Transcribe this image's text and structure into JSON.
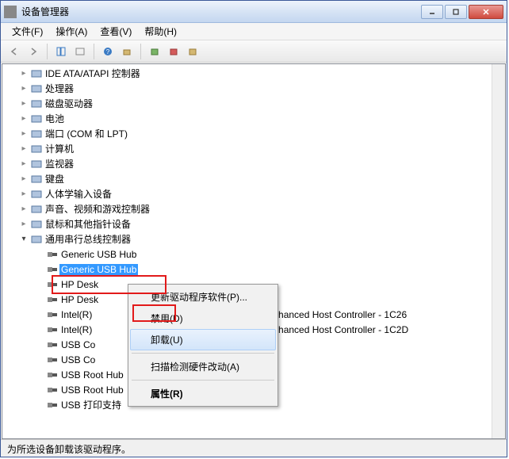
{
  "window": {
    "title": "设备管理器"
  },
  "menu": {
    "file": "文件(F)",
    "action": "操作(A)",
    "view": "查看(V)",
    "help": "帮助(H)"
  },
  "tree": {
    "items": [
      {
        "label": "IDE ATA/ATAPI 控制器",
        "indent": 1,
        "expanded": false
      },
      {
        "label": "处理器",
        "indent": 1,
        "expanded": false
      },
      {
        "label": "磁盘驱动器",
        "indent": 1,
        "expanded": false
      },
      {
        "label": "电池",
        "indent": 1,
        "expanded": false
      },
      {
        "label": "端口 (COM 和 LPT)",
        "indent": 1,
        "expanded": false
      },
      {
        "label": "计算机",
        "indent": 1,
        "expanded": false
      },
      {
        "label": "监视器",
        "indent": 1,
        "expanded": false
      },
      {
        "label": "键盘",
        "indent": 1,
        "expanded": false
      },
      {
        "label": "人体学输入设备",
        "indent": 1,
        "expanded": false
      },
      {
        "label": "声音、视频和游戏控制器",
        "indent": 1,
        "expanded": false
      },
      {
        "label": "鼠标和其他指针设备",
        "indent": 1,
        "expanded": false
      },
      {
        "label": "通用串行总线控制器",
        "indent": 1,
        "expanded": true
      },
      {
        "label": "Generic USB Hub",
        "indent": 2,
        "leaf": true
      },
      {
        "label": "Generic USB Hub",
        "indent": 2,
        "leaf": true,
        "selected": true
      },
      {
        "label": "HP Desk",
        "indent": 2,
        "leaf": true
      },
      {
        "label": "HP Desk",
        "indent": 2,
        "leaf": true
      },
      {
        "label": "Intel(R)",
        "indent": 2,
        "leaf": true,
        "suffix": "USB Enhanced Host Controller - 1C26"
      },
      {
        "label": "Intel(R)",
        "indent": 2,
        "leaf": true,
        "suffix": "USB Enhanced Host Controller - 1C2D"
      },
      {
        "label": "USB Co",
        "indent": 2,
        "leaf": true
      },
      {
        "label": "USB Co",
        "indent": 2,
        "leaf": true
      },
      {
        "label": "USB Root Hub",
        "indent": 2,
        "leaf": true
      },
      {
        "label": "USB Root Hub",
        "indent": 2,
        "leaf": true
      },
      {
        "label": "USB 打印支持",
        "indent": 2,
        "leaf": true
      }
    ]
  },
  "context_menu": {
    "update_driver": "更新驱动程序软件(P)...",
    "disable": "禁用(D)",
    "uninstall": "卸载(U)",
    "scan": "扫描检测硬件改动(A)",
    "properties": "属性(R)"
  },
  "statusbar": {
    "text": "为所选设备卸载该驱动程序。"
  }
}
